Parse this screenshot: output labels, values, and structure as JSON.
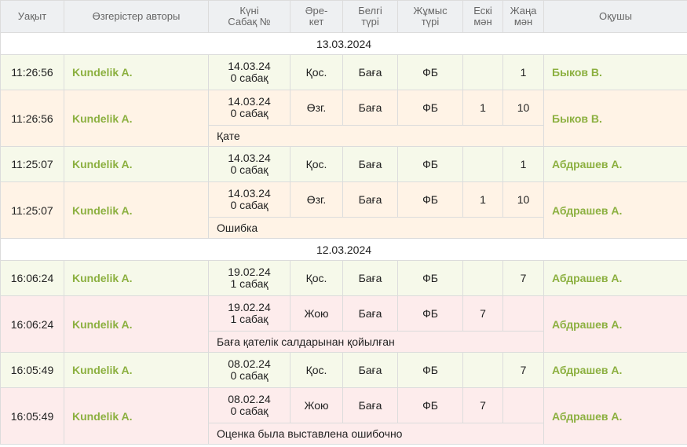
{
  "headers": {
    "time": "Уақыт",
    "author": "Өзгерістер авторы",
    "date_line1": "Күні",
    "date_line2": "Сабақ №",
    "action_line1": "Әре-",
    "action_line2": "кет",
    "mark_type_line1": "Белгі",
    "mark_type_line2": "түрі",
    "work_type_line1": "Жұмыс",
    "work_type_line2": "түрі",
    "old_line1": "Ескі",
    "old_line2": "мән",
    "new_line1": "Жаңа",
    "new_line2": "мән",
    "student": "Оқушы"
  },
  "groups": [
    {
      "date": "13.03.2024",
      "entries": [
        {
          "kind": "add",
          "time": "11:26:56",
          "author": "Kundelik A.",
          "lesson_date": "14.03.24",
          "lesson_no": "0 сабақ",
          "action": "Қос.",
          "mark_type": "Баға",
          "work_type": "ФБ",
          "old": "",
          "new": "1",
          "student": "Быков В.",
          "comment": ""
        },
        {
          "kind": "edit",
          "time": "11:26:56",
          "author": "Kundelik A.",
          "lesson_date": "14.03.24",
          "lesson_no": "0 сабақ",
          "action": "Өзг.",
          "mark_type": "Баға",
          "work_type": "ФБ",
          "old": "1",
          "new": "10",
          "student": "Быков В.",
          "comment": "Қате"
        },
        {
          "kind": "add",
          "time": "11:25:07",
          "author": "Kundelik A.",
          "lesson_date": "14.03.24",
          "lesson_no": "0 сабақ",
          "action": "Қос.",
          "mark_type": "Баға",
          "work_type": "ФБ",
          "old": "",
          "new": "1",
          "student": "Абдрашев А.",
          "comment": ""
        },
        {
          "kind": "edit",
          "time": "11:25:07",
          "author": "Kundelik A.",
          "lesson_date": "14.03.24",
          "lesson_no": "0 сабақ",
          "action": "Өзг.",
          "mark_type": "Баға",
          "work_type": "ФБ",
          "old": "1",
          "new": "10",
          "student": "Абдрашев А.",
          "comment": "Ошибка"
        }
      ]
    },
    {
      "date": "12.03.2024",
      "entries": [
        {
          "kind": "add",
          "time": "16:06:24",
          "author": "Kundelik A.",
          "lesson_date": "19.02.24",
          "lesson_no": "1 сабақ",
          "action": "Қос.",
          "mark_type": "Баға",
          "work_type": "ФБ",
          "old": "",
          "new": "7",
          "student": "Абдрашев А.",
          "comment": ""
        },
        {
          "kind": "del",
          "time": "16:06:24",
          "author": "Kundelik A.",
          "lesson_date": "19.02.24",
          "lesson_no": "1 сабақ",
          "action": "Жою",
          "mark_type": "Баға",
          "work_type": "ФБ",
          "old": "7",
          "new": "",
          "student": "Абдрашев А.",
          "comment": "Баға қателік салдарынан қойылған"
        },
        {
          "kind": "add",
          "time": "16:05:49",
          "author": "Kundelik A.",
          "lesson_date": "08.02.24",
          "lesson_no": "0 сабақ",
          "action": "Қос.",
          "mark_type": "Баға",
          "work_type": "ФБ",
          "old": "",
          "new": "7",
          "student": "Абдрашев А.",
          "comment": ""
        },
        {
          "kind": "del",
          "time": "16:05:49",
          "author": "Kundelik A.",
          "lesson_date": "08.02.24",
          "lesson_no": "0 сабақ",
          "action": "Жою",
          "mark_type": "Баға",
          "work_type": "ФБ",
          "old": "7",
          "new": "",
          "student": "Абдрашев А.",
          "comment": "Оценка была выставлена ошибочно"
        }
      ]
    }
  ],
  "colors": {
    "add": "#f6f9ea",
    "edit": "#fff3e6",
    "del": "#fdecec",
    "name": "#8cb040"
  }
}
